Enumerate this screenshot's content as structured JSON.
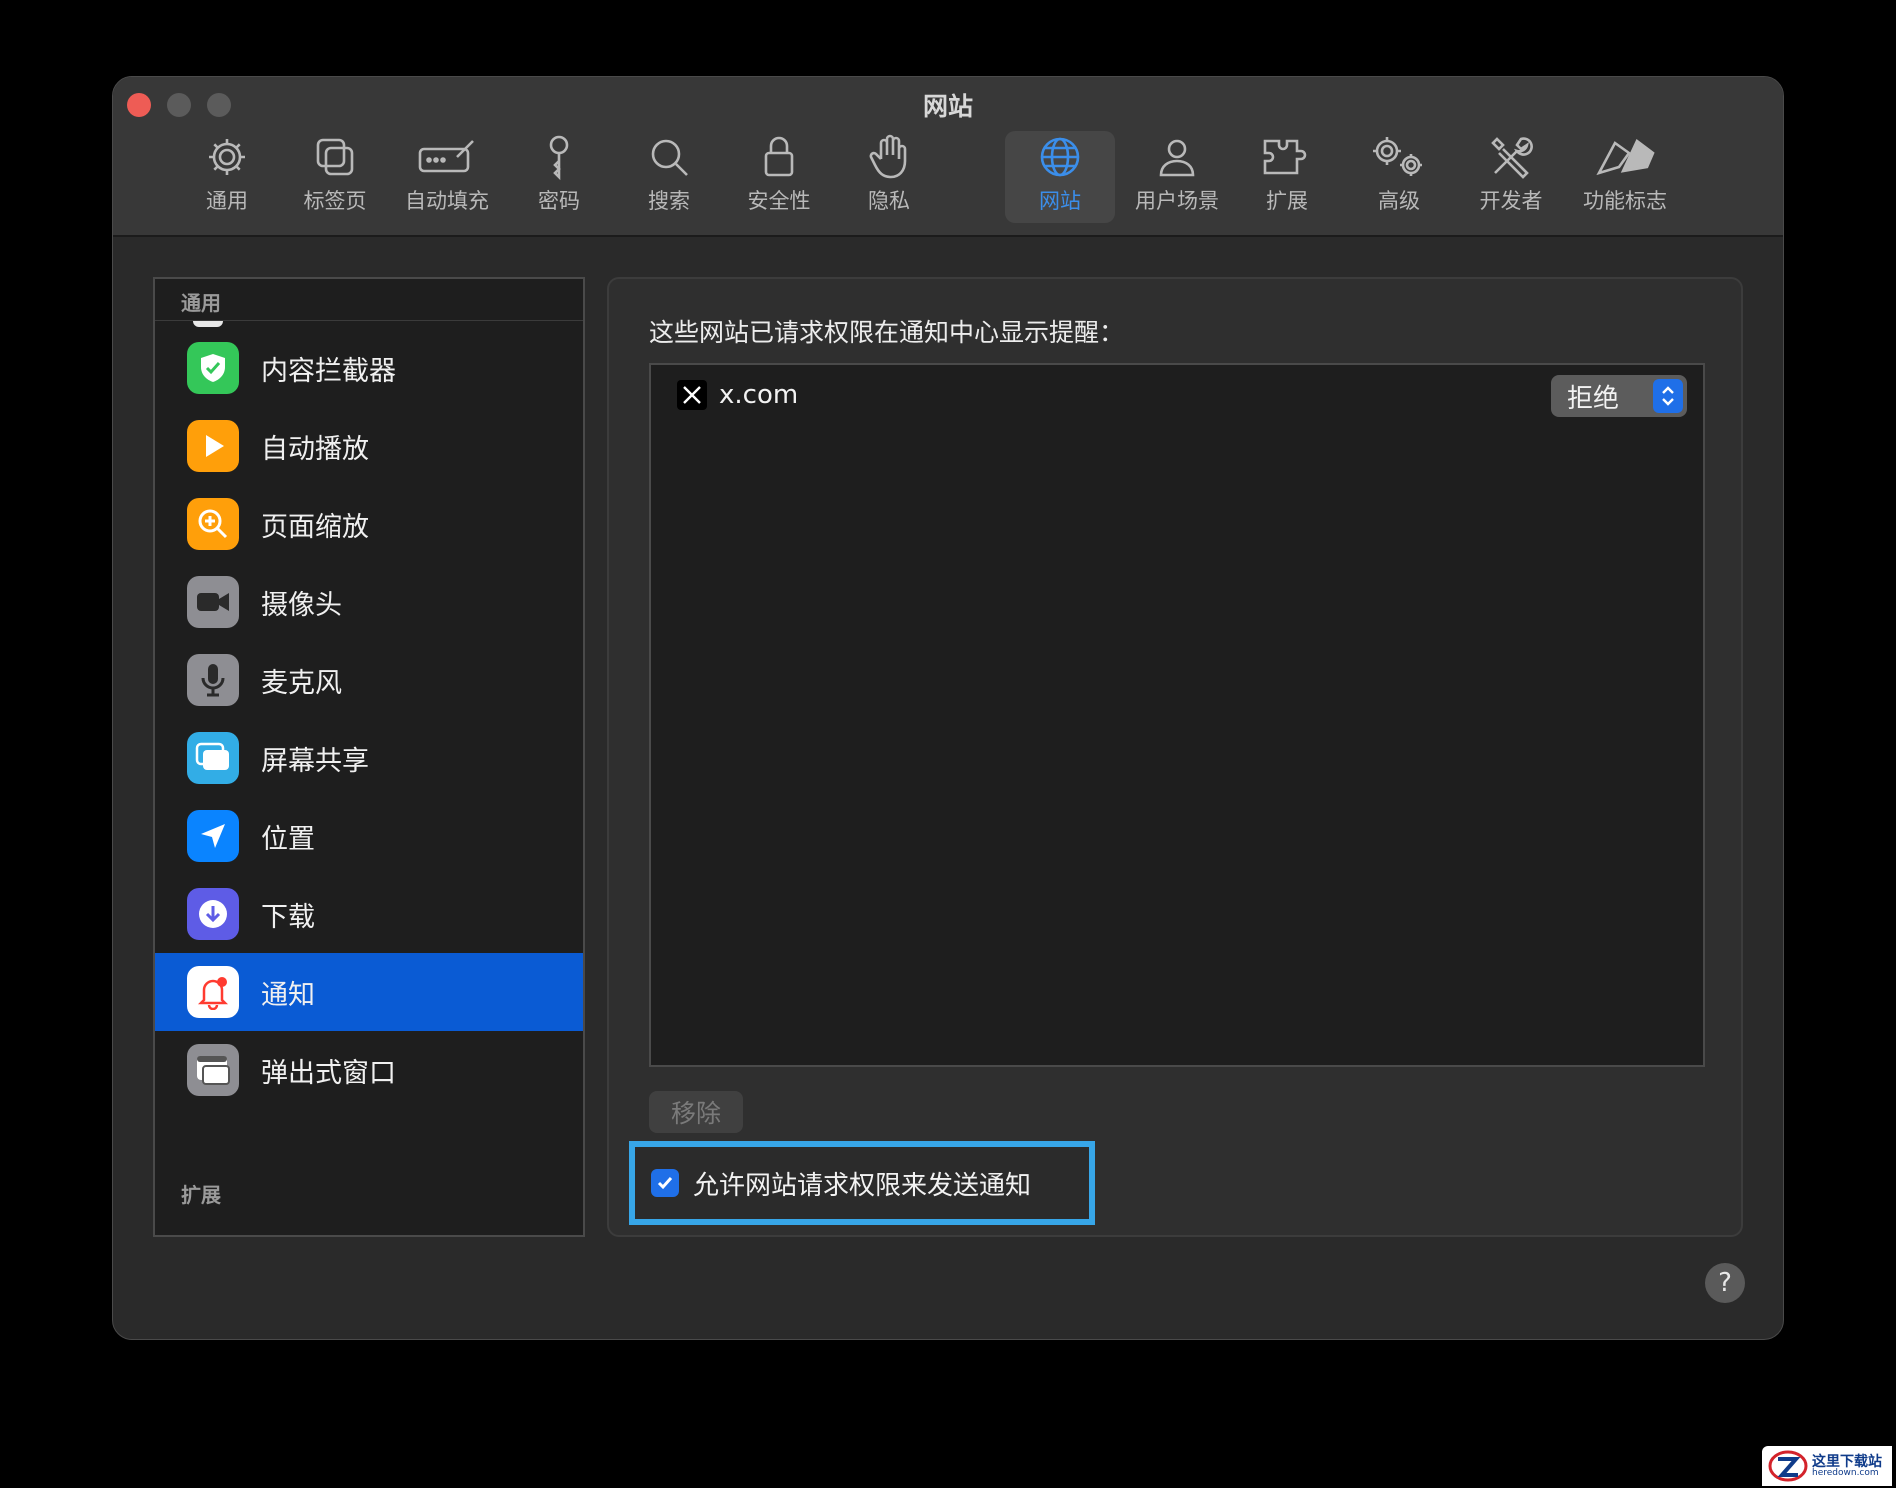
{
  "window": {
    "title": "网站"
  },
  "toolbar": {
    "items": [
      {
        "label": "通用",
        "icon": "gear-icon"
      },
      {
        "label": "标签页",
        "icon": "tabs-icon"
      },
      {
        "label": "自动填充",
        "icon": "autofill-icon"
      },
      {
        "label": "密码",
        "icon": "key-icon"
      },
      {
        "label": "搜索",
        "icon": "search-icon"
      },
      {
        "label": "安全性",
        "icon": "lock-icon"
      },
      {
        "label": "隐私",
        "icon": "hand-icon"
      },
      {
        "label": "网站",
        "icon": "globe-icon"
      },
      {
        "label": "用户场景",
        "icon": "person-icon"
      },
      {
        "label": "扩展",
        "icon": "puzzle-icon"
      },
      {
        "label": "高级",
        "icon": "gears-icon"
      },
      {
        "label": "开发者",
        "icon": "tools-icon"
      },
      {
        "label": "功能标志",
        "icon": "flags-icon"
      }
    ],
    "active": "网站",
    "accent": "#3b8eea"
  },
  "sidebar": {
    "header": "通用",
    "items": [
      {
        "label": "内容拦截器",
        "icon": "shield-check-icon",
        "color": "#34c759"
      },
      {
        "label": "自动播放",
        "icon": "play-icon",
        "color": "#ff9f0a"
      },
      {
        "label": "页面缩放",
        "icon": "zoom-icon",
        "color": "#ff9f0a"
      },
      {
        "label": "摄像头",
        "icon": "camera-icon",
        "color": "#8e8e93"
      },
      {
        "label": "麦克风",
        "icon": "microphone-icon",
        "color": "#8e8e93"
      },
      {
        "label": "屏幕共享",
        "icon": "screen-share-icon",
        "color": "#32ade6"
      },
      {
        "label": "位置",
        "icon": "location-icon",
        "color": "#0a84ff"
      },
      {
        "label": "下载",
        "icon": "download-icon",
        "color": "#5e5ce6"
      },
      {
        "label": "通知",
        "icon": "bell-icon",
        "color": "#ffffff"
      },
      {
        "label": "弹出式窗口",
        "icon": "popup-window-icon",
        "color": "#8e8e93"
      }
    ],
    "selected": "通知",
    "footer": "扩展"
  },
  "panel": {
    "title": "这些网站已请求权限在通知中心显示提醒：",
    "sites": [
      {
        "name": "x.com",
        "permission": "拒绝"
      }
    ],
    "remove_label": "移除",
    "allow_label": "允许网站请求权限来发送通知",
    "allow_checked": true
  },
  "help": {
    "label": "?"
  },
  "watermark": {
    "cn": "这里下载站",
    "en": "heredown.com"
  }
}
